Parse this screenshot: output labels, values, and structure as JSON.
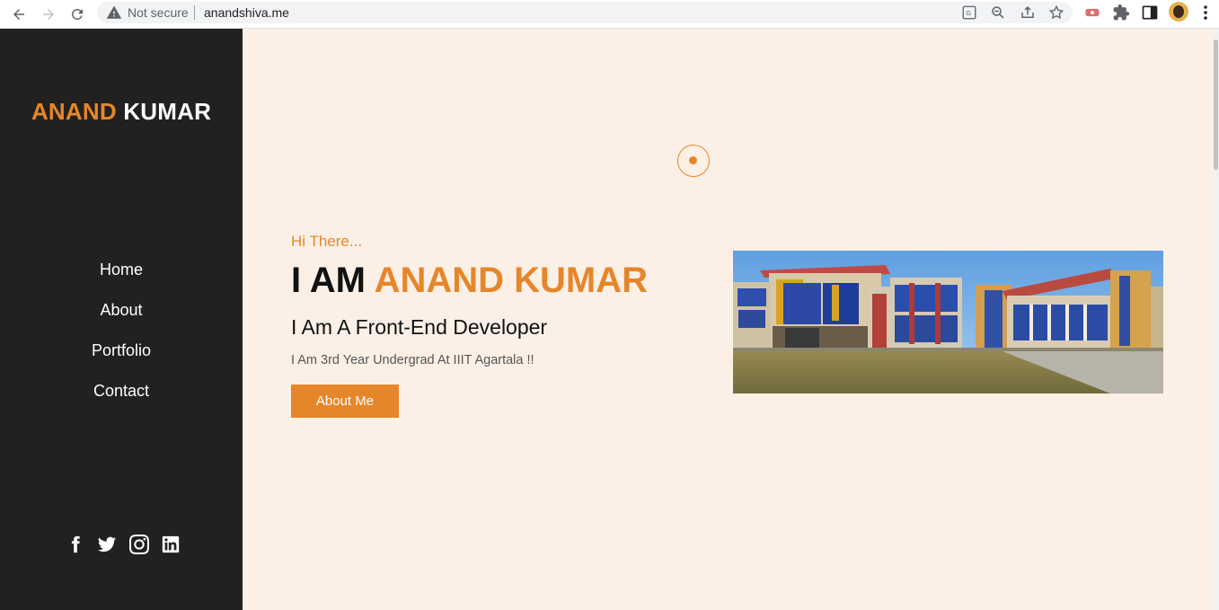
{
  "browser": {
    "security_label": "Not secure",
    "url": "anandshiva.me"
  },
  "sidebar": {
    "brand_first": "ANAND",
    "brand_last": "KUMAR",
    "menu": [
      {
        "label": "Home"
      },
      {
        "label": "About"
      },
      {
        "label": "Portfolio"
      },
      {
        "label": "Contact"
      }
    ],
    "socials": [
      "facebook-icon",
      "twitter-icon",
      "instagram-icon",
      "linkedin-icon"
    ]
  },
  "hero": {
    "greeting": "Hi There...",
    "headline_prefix": "I AM",
    "headline_name": "ANAND KUMAR",
    "role": "I Am A Front-End Developer",
    "description": "I Am 3rd Year Undergrad At IIIT Agartala !!",
    "cta_label": "About Me"
  },
  "colors": {
    "accent": "#e6862a",
    "sidebar_bg": "#212121",
    "page_bg": "#fcf0e6"
  }
}
